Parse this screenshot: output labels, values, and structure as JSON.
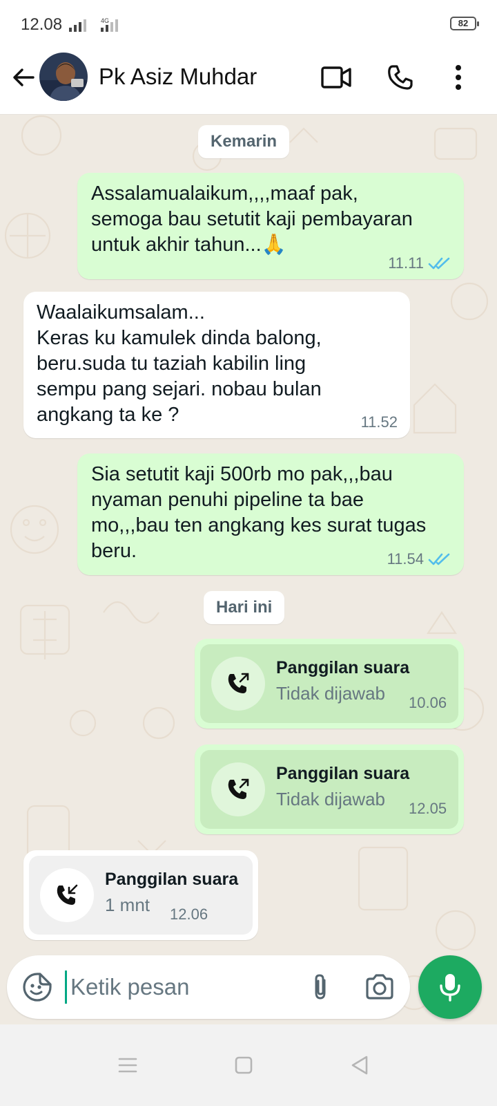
{
  "status_bar": {
    "time": "12.08",
    "network": "4G",
    "battery": "82"
  },
  "header": {
    "contact_name": "Pk Asiz Muhdar",
    "icons": [
      "back-arrow-icon",
      "video-call-icon",
      "voice-call-icon",
      "more-options-icon"
    ]
  },
  "chat": {
    "date_separators": [
      "Kemarin",
      "Hari ini"
    ],
    "messages": [
      {
        "direction": "out",
        "text": "Assalamualaikum,,,,maaf pak,\nsemoga bau setutit kaji pembayaran\nuntuk akhir tahun...🙏",
        "time": "11.11",
        "status": "read"
      },
      {
        "direction": "in",
        "text": "Waalaikumsalam...\nKeras ku kamulek dinda balong,\nberu.suda tu taziah kabilin ling\nsempu pang sejari. nobau bulan\nangkang ta ke ?",
        "time": "11.52"
      },
      {
        "direction": "out",
        "text": "Sia setutit kaji 500rb mo pak,,,bau\nnyaman penuhi pipeline ta bae\nmo,,,bau ten angkang kes surat tugas\nberu.",
        "time": "11.54",
        "status": "read"
      }
    ],
    "calls": [
      {
        "direction": "out",
        "title": "Panggilan suara",
        "subtitle": "Tidak dijawab",
        "time": "10.06",
        "icon": "outgoing-call-icon"
      },
      {
        "direction": "out",
        "title": "Panggilan suara",
        "subtitle": "Tidak dijawab",
        "time": "12.05",
        "icon": "outgoing-call-icon"
      },
      {
        "direction": "in",
        "title": "Panggilan suara",
        "subtitle": "1 mnt",
        "time": "12.06",
        "icon": "incoming-call-icon"
      }
    ]
  },
  "composer": {
    "placeholder": "Ketik pesan"
  },
  "colors": {
    "outgoing_bubble": "#d9fdd3",
    "incoming_bubble": "#ffffff",
    "accent": "#1daa61",
    "read_tick": "#53bdeb"
  }
}
